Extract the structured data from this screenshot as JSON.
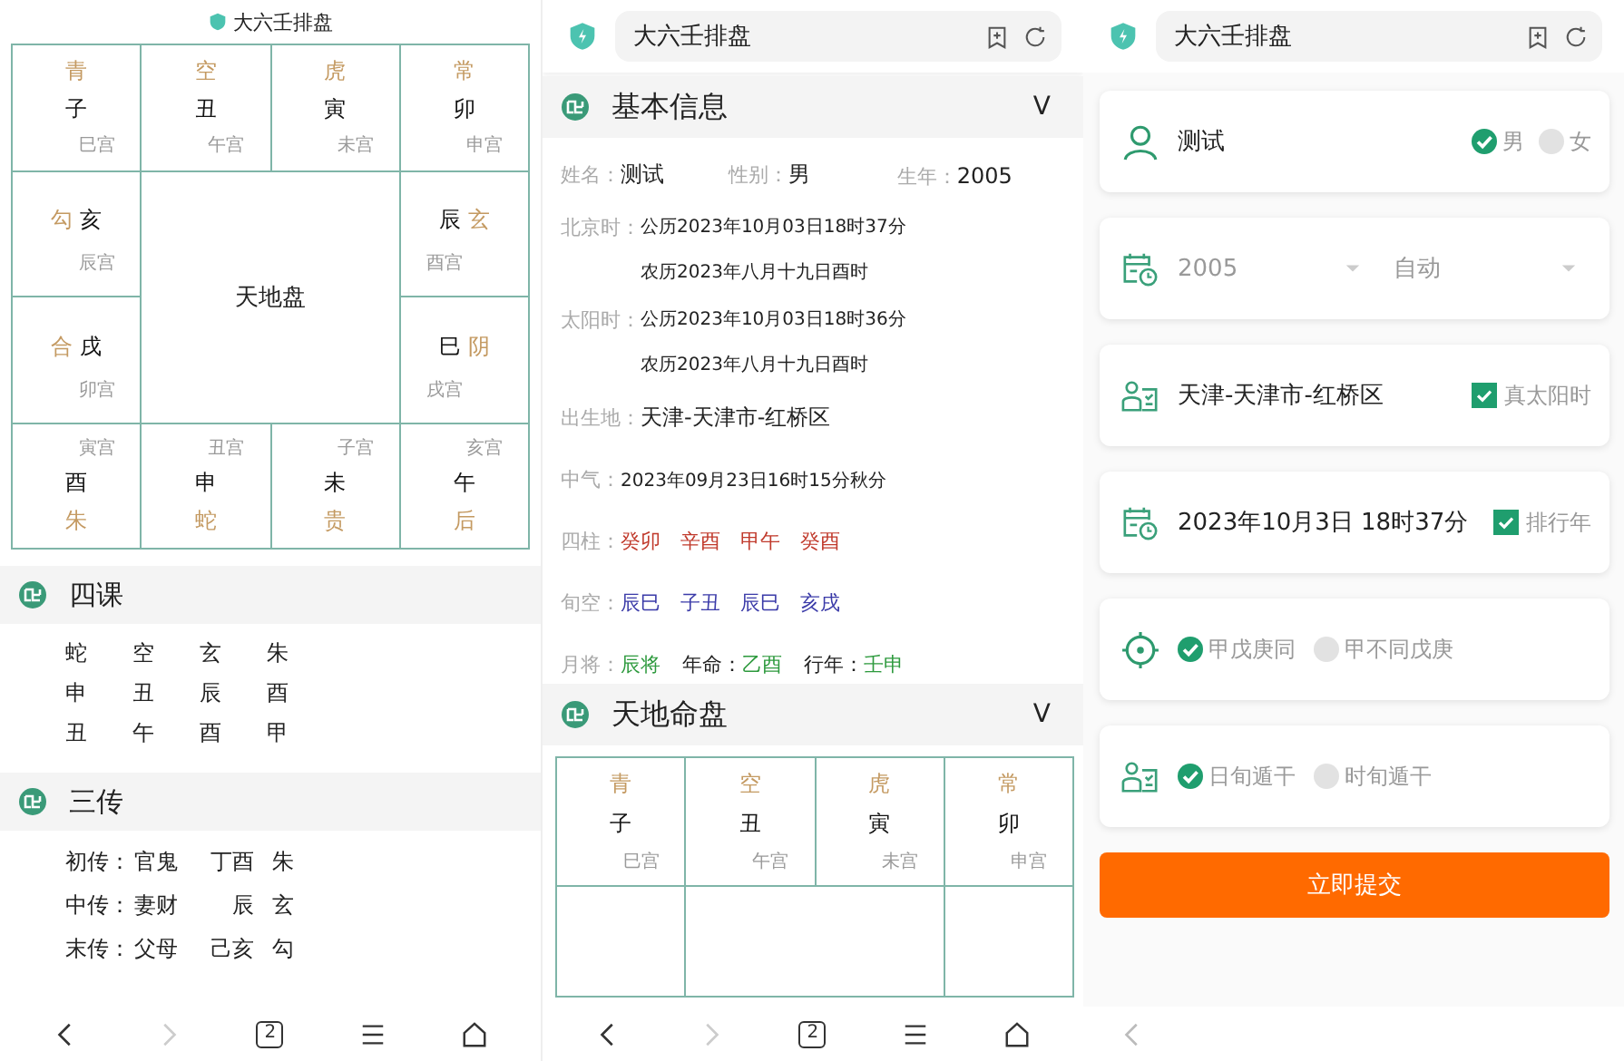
{
  "chart_screen": {
    "title": "大六壬排盘",
    "board": {
      "center": "天地盘",
      "top": [
        {
          "god": "青",
          "branch": "子",
          "palace": "巳宫"
        },
        {
          "god": "空",
          "branch": "丑",
          "palace": "午宫"
        },
        {
          "god": "虎",
          "branch": "寅",
          "palace": "未宫"
        },
        {
          "god": "常",
          "branch": "卯",
          "palace": "申宫"
        }
      ],
      "left": [
        {
          "god": "勾",
          "branch": "亥",
          "palace": "辰宫"
        },
        {
          "god": "合",
          "branch": "戌",
          "palace": "卯宫"
        }
      ],
      "right": [
        {
          "god": "玄",
          "branch": "辰",
          "palace": "酉宫"
        },
        {
          "god": "阴",
          "branch": "巳",
          "palace": "戌宫"
        }
      ],
      "bottom": [
        {
          "god": "朱",
          "branch": "酉",
          "palace": "寅宫"
        },
        {
          "god": "蛇",
          "branch": "申",
          "palace": "丑宫"
        },
        {
          "god": "贵",
          "branch": "未",
          "palace": "子宫"
        },
        {
          "god": "后",
          "branch": "午",
          "palace": "亥宫"
        }
      ]
    },
    "sike": {
      "title": "四课",
      "rows": [
        [
          "蛇",
          "空",
          "玄",
          "朱"
        ],
        [
          "申",
          "丑",
          "辰",
          "酉"
        ],
        [
          "丑",
          "午",
          "酉",
          "甲"
        ]
      ]
    },
    "sanchuan": {
      "title": "三传",
      "rows": [
        {
          "label": "初传：",
          "relation": "官鬼",
          "ganzhi": "丁酉",
          "god": "朱"
        },
        {
          "label": "中传：",
          "relation": "妻财",
          "ganzhi": "辰",
          "god": "玄"
        },
        {
          "label": "末传：",
          "relation": "父母",
          "ganzhi": "己亥",
          "god": "勾"
        }
      ]
    },
    "nav_bar": {
      "tab_count": "2",
      "forward_disabled": true
    }
  },
  "info_screen": {
    "address_bar": {
      "title": "大六壬排盘"
    },
    "basic_info": {
      "title": "基本信息",
      "toggle": "V",
      "fields": [
        {
          "label": "姓名：",
          "value": "测试"
        },
        {
          "label": "性别：",
          "value": "男"
        },
        {
          "label": "生年：",
          "value": "2005"
        }
      ],
      "times": [
        {
          "label": "北京时：",
          "lines": [
            "公历2023年10月03日18时37分",
            "农历2023年八月十九日酉时"
          ]
        },
        {
          "label": "太阳时：",
          "lines": [
            "公历2023年10月03日18时36分",
            "农历2023年八月十九日酉时"
          ]
        }
      ],
      "birthplace": {
        "label": "出生地：",
        "value": "天津-天津市-红桥区"
      },
      "zhongqi": {
        "label": "中气：",
        "value": "2023年09月23日16时15分秋分"
      },
      "ganzhi_rows": [
        {
          "label": "四柱：",
          "color": "#c0392b",
          "values": [
            "癸卯",
            "辛酉",
            "甲午",
            "癸酉"
          ]
        },
        {
          "label": "旬空：",
          "color": "#3a3aa8",
          "values": [
            "辰巳",
            "子丑",
            "辰巳",
            "亥戌"
          ]
        }
      ],
      "month_row": [
        {
          "label": "月将：",
          "value": "辰将"
        },
        {
          "label": "年命：",
          "value": "乙酉"
        },
        {
          "label": "行年：",
          "value": "壬申"
        }
      ]
    },
    "board_section": {
      "title": "天地命盘",
      "toggle": "V",
      "top": [
        {
          "god": "青",
          "branch": "子",
          "palace": "巳宫"
        },
        {
          "god": "空",
          "branch": "丑",
          "palace": "午宫"
        },
        {
          "god": "虎",
          "branch": "寅",
          "palace": "未宫"
        },
        {
          "god": "常",
          "branch": "卯",
          "palace": "申宫"
        }
      ]
    },
    "nav_bar": {
      "tab_count": "2",
      "forward_disabled": true
    }
  },
  "form_screen": {
    "address_bar": {
      "title": "大六壬排盘"
    },
    "cards": [
      {
        "kind": "name",
        "value": "测试",
        "options": [
          {
            "label": "男",
            "selected": true
          },
          {
            "label": "女",
            "selected": false
          }
        ]
      },
      {
        "kind": "selects",
        "selects": [
          {
            "value": "2005",
            "disabled": true
          },
          {
            "value": "自动",
            "disabled": true
          }
        ]
      },
      {
        "kind": "text_check",
        "value": "天津-天津市-红桥区",
        "check": {
          "label": "真太阳时",
          "checked": true
        }
      },
      {
        "kind": "text_check",
        "value": "2023年10月3日 18时37分",
        "check": {
          "label": "排行年",
          "checked": true
        }
      },
      {
        "kind": "radios",
        "options": [
          {
            "label": "甲戊庚同",
            "selected": true
          },
          {
            "label": "甲不同戊庚",
            "selected": false
          }
        ]
      },
      {
        "kind": "radios",
        "options": [
          {
            "label": "日旬遁干",
            "selected": true
          },
          {
            "label": "时旬遁干",
            "selected": false
          }
        ]
      }
    ],
    "submit": "立即提交"
  }
}
